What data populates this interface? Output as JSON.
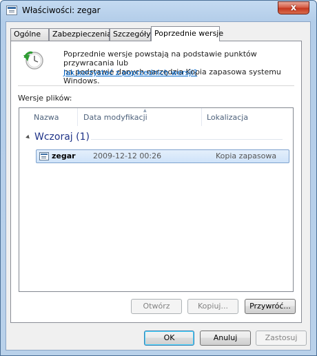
{
  "window": {
    "title": "Właściwości: zegar",
    "close_glyph": "x"
  },
  "tabs": [
    {
      "label": "Ogólne"
    },
    {
      "label": "Zabezpieczenia"
    },
    {
      "label": "Szczegóły"
    },
    {
      "label": "Poprzednie wersje"
    }
  ],
  "info": {
    "line1": "Poprzednie wersje powstają na podstawie punktów przywracania lub",
    "line2": "na podstawie danych narzędzia Kopia zapasowa systemu Windows.",
    "link": "Jak korzystać z poprzednich wersji?",
    "icon": "restore-clock-icon"
  },
  "files_label": "Wersje plików:",
  "list": {
    "columns": [
      "Nazwa",
      "Data modyfikacji",
      "Lokalizacja"
    ],
    "group": "Wczoraj (1)",
    "rows": [
      {
        "name": "zegar",
        "date": "2009-12-12 00:26",
        "location": "Kopia zapasowa",
        "icon": "file-icon"
      }
    ]
  },
  "buttons": {
    "open": "Otwórz",
    "copy": "Kopiuj...",
    "restore": "Przywróć...",
    "ok": "OK",
    "cancel": "Anuluj",
    "apply": "Zastosuj"
  },
  "colors": {
    "accent": "#0066cc",
    "group_header": "#1e3287",
    "selection": "#cfe3f9",
    "close_button": "#c4351d"
  }
}
